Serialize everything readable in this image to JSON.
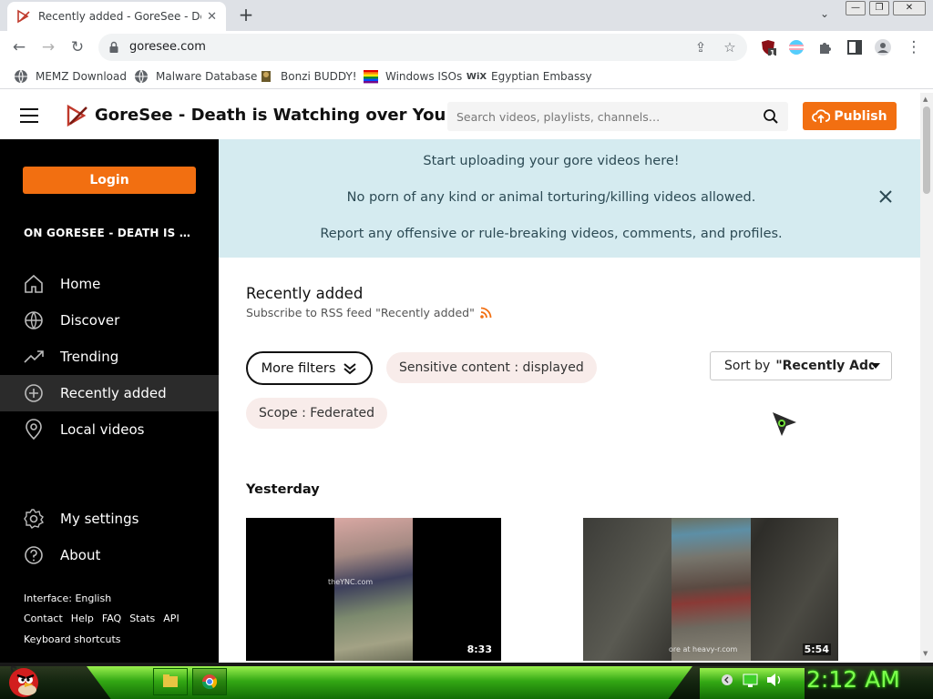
{
  "browser": {
    "tab_title": "Recently added - GoreSee - Death is Watching over You",
    "tab_close": "✕",
    "new_tab": "+",
    "tab_search": "⌄",
    "url": "goresee.com",
    "win_minimize": "—",
    "win_restore": "❐",
    "win_close": "✕"
  },
  "toolbar": {
    "back": "←",
    "forward": "→",
    "reload": "↻",
    "share": "⇪",
    "star": "☆",
    "ext_badge": "1",
    "menu": "⋮"
  },
  "bookmarks": [
    {
      "label": "MEMZ Download",
      "icon": "globe-icon"
    },
    {
      "label": "Malware Database",
      "icon": "globe-icon"
    },
    {
      "label": "Bonzi BUDDY!",
      "icon": "bonzi-icon"
    },
    {
      "label": "Windows ISOs",
      "icon": "windows-flag-icon"
    },
    {
      "label": "Egyptian Embassy",
      "icon": "wix-icon",
      "icon_text": "WiX"
    }
  ],
  "header": {
    "site_title": "GoreSee - Death is Watching over You",
    "search_placeholder": "Search videos, playlists, channels…",
    "publish_label": "Publish",
    "accent": "#f26f11"
  },
  "sidebar": {
    "login_label": "Login",
    "instance_name": "ON GORESEE - DEATH IS WATCHING OVER YOU",
    "nav": [
      {
        "label": "Home",
        "icon": "home-icon"
      },
      {
        "label": "Discover",
        "icon": "globe-icon"
      },
      {
        "label": "Trending",
        "icon": "trending-icon"
      },
      {
        "label": "Recently added",
        "icon": "plus-circle-icon",
        "active": true
      },
      {
        "label": "Local videos",
        "icon": "location-icon"
      }
    ],
    "settings_label": "My settings",
    "about_label": "About",
    "footer": {
      "interface": "Interface: English",
      "links": [
        "Contact",
        "Help",
        "FAQ",
        "Stats",
        "API"
      ],
      "shortcuts": "Keyboard shortcuts"
    }
  },
  "notice": {
    "lines": [
      "Start uploading your gore videos here!",
      "No porn of any kind or animal torturing/killing videos allowed.",
      "Report any offensive or rule-breaking videos, comments, and profiles."
    ],
    "bg": "#d5ebf0"
  },
  "main": {
    "title": "Recently added",
    "rss_text": "Subscribe to RSS feed \"Recently added\"",
    "more_filters_label": "More filters",
    "sensitive_pill": "Sensitive content : displayed",
    "scope_pill": "Scope : Federated",
    "sort_prefix": "Sort by",
    "sort_value": "\"Recently Added\"",
    "section_yesterday": "Yesterday",
    "videos": [
      {
        "duration": "8:33",
        "watermark": "theYNC.com"
      },
      {
        "duration": "5:54",
        "watermark": "ore at heavy-r.com"
      }
    ]
  },
  "taskbar": {
    "clock": "2:12 AM"
  }
}
